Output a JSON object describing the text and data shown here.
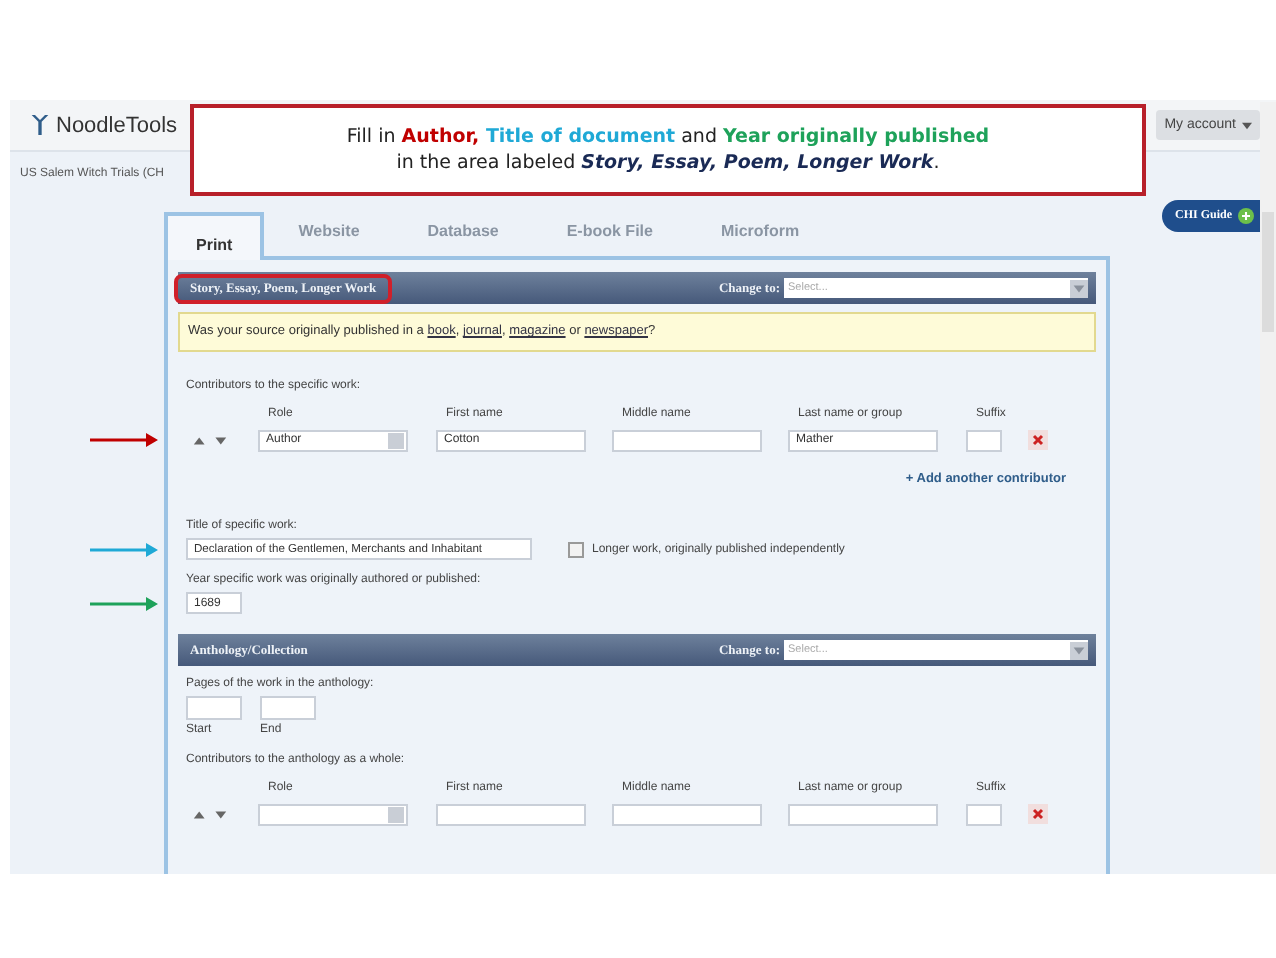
{
  "header": {
    "logo": "NoodleTools",
    "account": "My account",
    "project": "US Salem Witch Trials (CH"
  },
  "callout": {
    "line1": [
      {
        "text": "Fill in ",
        "color": "#222222",
        "bold": false
      },
      {
        "text": "Author,",
        "color": "#c00000",
        "bold": true
      },
      {
        "text": " Title  of document",
        "color": "#1fa9d6",
        "bold": true
      },
      {
        "text": " and ",
        "color": "#222222",
        "bold": false
      },
      {
        "text": "Year originally published",
        "color": "#1ea25a",
        "bold": true
      }
    ],
    "line2": "in the area labeled *Story, Essay, Poem, Longer Work*."
  },
  "tabs": [
    {
      "label": "Print",
      "selected": true
    },
    {
      "label": "Website",
      "selected": false
    },
    {
      "label": "Database",
      "selected": false
    },
    {
      "label": "E-book File",
      "selected": false
    },
    {
      "label": "Microform",
      "selected": false
    }
  ],
  "guide": {
    "label": "CHI Guide"
  },
  "sections": [
    {
      "kind": "work",
      "title": "Story, Essay, Poem, Longer Work",
      "highlighted": true,
      "change_to": "Change to:",
      "select": {
        "placeholder": "Select..."
      },
      "notice": [
        {
          "text": "Was your source originally published in a ",
          "link": false
        },
        {
          "text": "book",
          "link": true
        },
        {
          "text": ", ",
          "link": false
        },
        {
          "text": "journal",
          "link": true
        },
        {
          "text": ", ",
          "link": false
        },
        {
          "text": "magazine",
          "link": true
        },
        {
          "text": " or ",
          "link": false
        },
        {
          "text": "newspaper",
          "link": true
        },
        {
          "text": "?",
          "link": false
        }
      ],
      "contributors": {
        "label": "Contributors to the specific work:",
        "columns": [
          "Role",
          "First name",
          "Middle name",
          "Last name or group",
          "Suffix"
        ],
        "row": {
          "role": "Author",
          "first": "Cotton",
          "last": "Mather",
          "pointer": {
            "color": "#c00000"
          }
        },
        "add": "+ Add another contributor"
      },
      "title_field": {
        "label": "Title of specific work:",
        "value": "Declaration of the Gentlemen, Merchants and Inhabitant",
        "pointer": {
          "color": "#1fa9d6"
        },
        "checkbox": {
          "label": "Longer work, originally published independently",
          "checked": false
        }
      },
      "year_field": {
        "label": "Year specific work was originally authored or published:",
        "value": "1689",
        "pointer": {
          "color": "#1ea25a"
        }
      }
    },
    {
      "kind": "anthology",
      "title": "Anthology/Collection",
      "highlighted": false,
      "change_to": "Change to:",
      "select": {
        "placeholder": "Select..."
      },
      "pages": {
        "label": "Pages of the work in the anthology:",
        "start": "Start",
        "end": "End"
      },
      "contributors": {
        "label": "Contributors to the anthology as a whole:",
        "columns": [
          "Role",
          "First name",
          "Middle name",
          "Last name or group",
          "Suffix"
        ]
      }
    }
  ]
}
